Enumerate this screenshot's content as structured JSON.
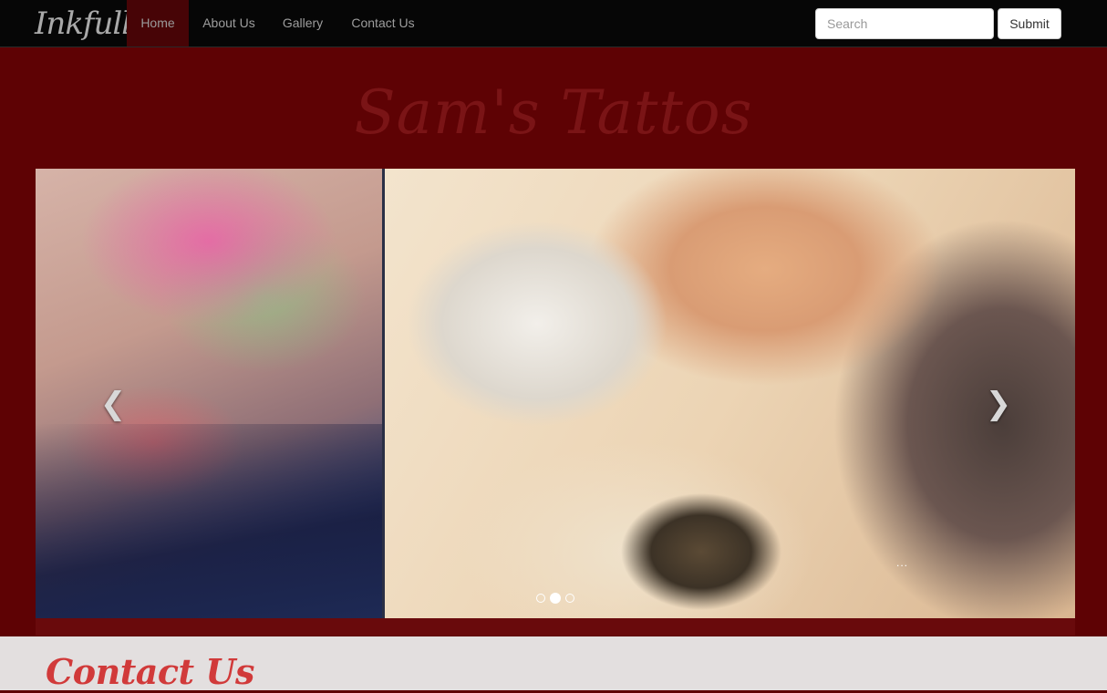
{
  "navbar": {
    "brand": "Inkfull",
    "items": [
      {
        "label": "Home",
        "active": true
      },
      {
        "label": "About Us",
        "active": false
      },
      {
        "label": "Gallery",
        "active": false
      },
      {
        "label": "Contact Us",
        "active": false
      }
    ],
    "search": {
      "placeholder": "Search",
      "value": ""
    },
    "submit_label": "Submit"
  },
  "hero": {
    "title": "Sam's Tattos"
  },
  "carousel": {
    "prev_icon": "chevron-left-icon",
    "next_icon": "chevron-right-icon",
    "prev_glyph": "❮",
    "next_glyph": "❯",
    "slide_count": 3,
    "active_index": 1,
    "caption": "..."
  },
  "contact": {
    "heading": "Contact Us"
  },
  "colors": {
    "navbar_bg": "#060606",
    "page_bg": "#5e0204",
    "active_nav_bg": "#470406",
    "contact_heading": "#d13a3a",
    "contact_bg": "#e3dfdf"
  }
}
